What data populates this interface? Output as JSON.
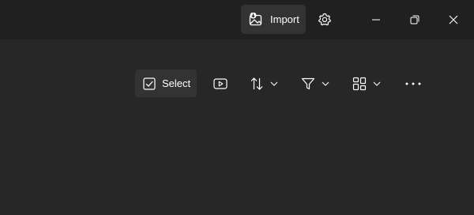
{
  "titlebar": {
    "import_label": "Import"
  },
  "toolbar": {
    "select_label": "Select"
  },
  "icons": {
    "import": "image-import-icon",
    "settings": "gear-icon",
    "minimize": "minimize-icon",
    "restore": "restore-icon",
    "close": "close-icon",
    "select": "checkbox-icon",
    "slideshow": "slideshow-play-icon",
    "sort": "sort-arrows-icon",
    "filter": "filter-icon",
    "view": "view-layout-icon",
    "more": "more-dots-icon",
    "chevron": "chevron-down-icon"
  },
  "colors": {
    "background": "#272727",
    "titlebar": "#202020",
    "button_fill": "#333333",
    "foreground": "#ffffff"
  }
}
